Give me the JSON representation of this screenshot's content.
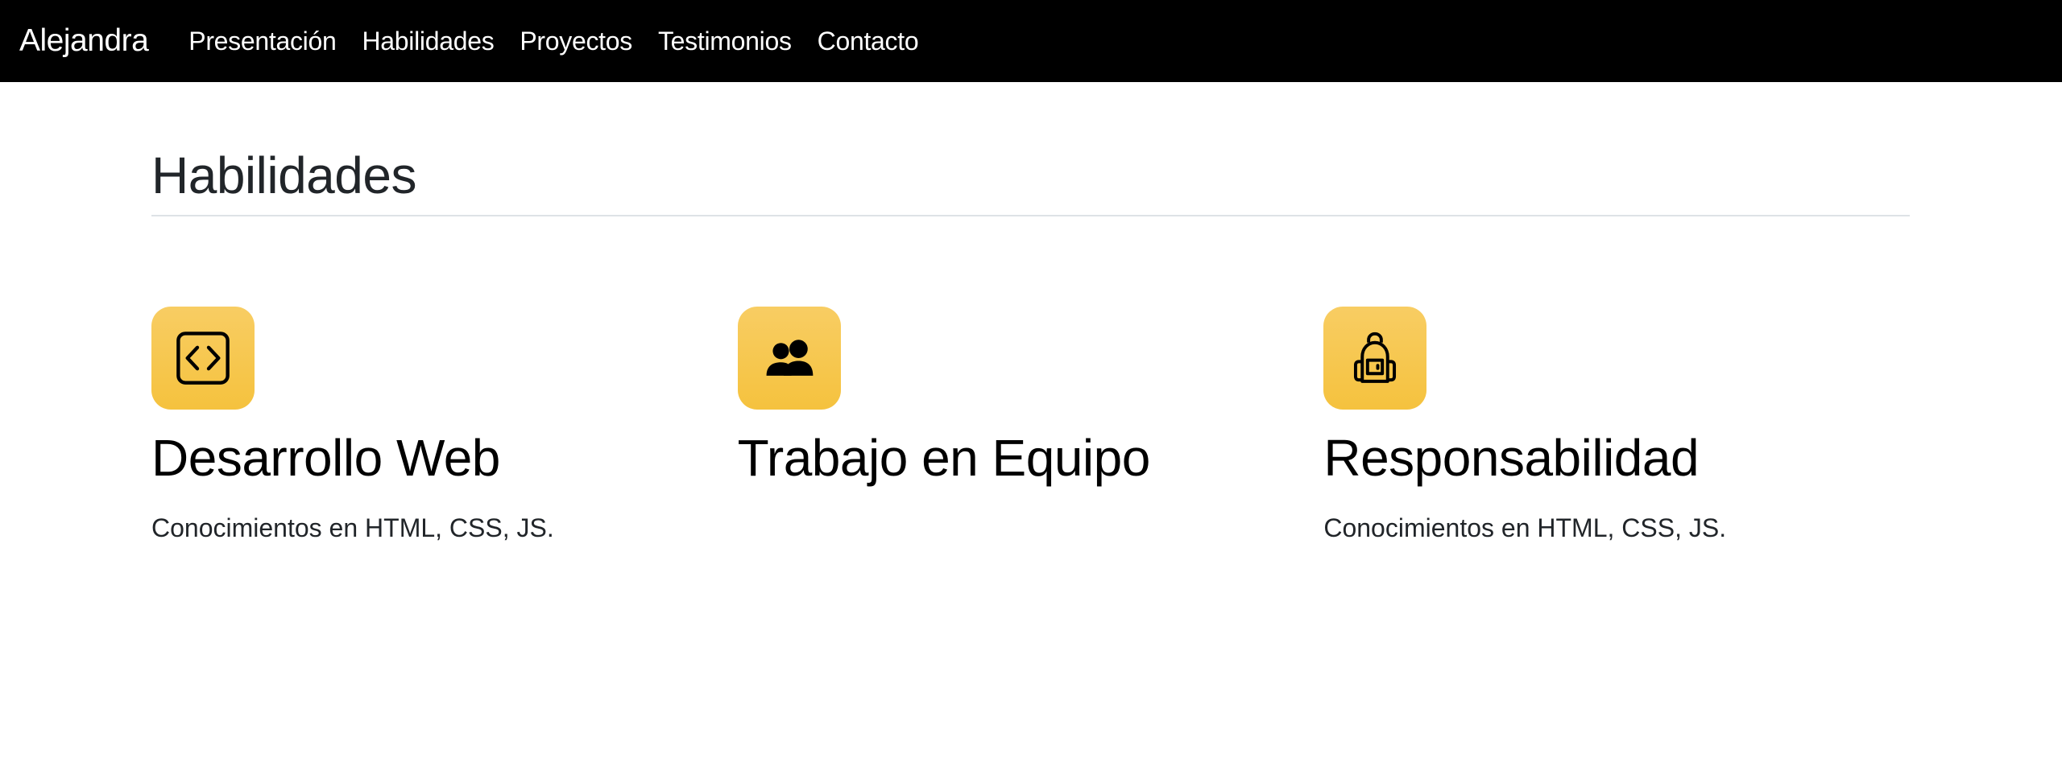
{
  "navbar": {
    "brand": "Alejandra",
    "links": [
      {
        "label": "Presentación"
      },
      {
        "label": "Habilidades"
      },
      {
        "label": "Proyectos"
      },
      {
        "label": "Testimonios"
      },
      {
        "label": "Contacto"
      }
    ]
  },
  "skills": {
    "title": "Habilidades",
    "items": [
      {
        "icon": "code-square-icon",
        "title": "Desarrollo Web",
        "text": "Conocimientos en HTML, CSS, JS."
      },
      {
        "icon": "people-icon",
        "title": "Trabajo en Equipo",
        "text": ""
      },
      {
        "icon": "backpack-icon",
        "title": "Responsabilidad",
        "text": "Conocimientos en HTML, CSS, JS."
      }
    ]
  },
  "colors": {
    "navbar_bg": "#000000",
    "icon_bg": "#f5c23e",
    "divider": "#dee2e6"
  }
}
